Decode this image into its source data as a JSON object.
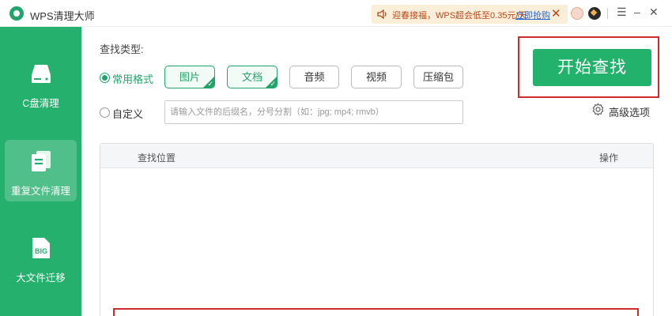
{
  "app": {
    "title": "WPS清理大师"
  },
  "promo": {
    "text": "迎春接福，WPS超会低至0.35元/天",
    "link": "立即抢购",
    "close": "✕"
  },
  "window_controls": {
    "menu": "☰",
    "minimize": "–",
    "close": "✕"
  },
  "sidebar": {
    "items": [
      {
        "label": "C盘清理",
        "icon": "disk-icon",
        "active": false
      },
      {
        "label": "重复文件清理",
        "icon": "duplicate-file-icon",
        "active": true
      },
      {
        "label": "大文件迁移",
        "icon": "big-file-icon",
        "active": false,
        "icon_text": "BIG"
      }
    ]
  },
  "main": {
    "type_label": "查找类型:",
    "common_format": {
      "label": "常用格式",
      "selected": true
    },
    "custom": {
      "label": "自定义",
      "selected": false,
      "placeholder": "请输入文件的后缀名，分号分割（如：jpg; mp4; rmvb）"
    },
    "formats": [
      {
        "label": "图片",
        "selected": true
      },
      {
        "label": "文档",
        "selected": true
      },
      {
        "label": "音频",
        "selected": false
      },
      {
        "label": "视频",
        "selected": false
      },
      {
        "label": "压缩包",
        "selected": false
      }
    ],
    "start_button": "开始查找",
    "advanced": "高级选项",
    "table": {
      "col_location": "查找位置",
      "col_action": "操作"
    }
  },
  "colors": {
    "accent": "#22b26c",
    "sidebar": "#26b06d",
    "highlight": "#d02a2a",
    "promo_bg": "#fbefd9"
  }
}
